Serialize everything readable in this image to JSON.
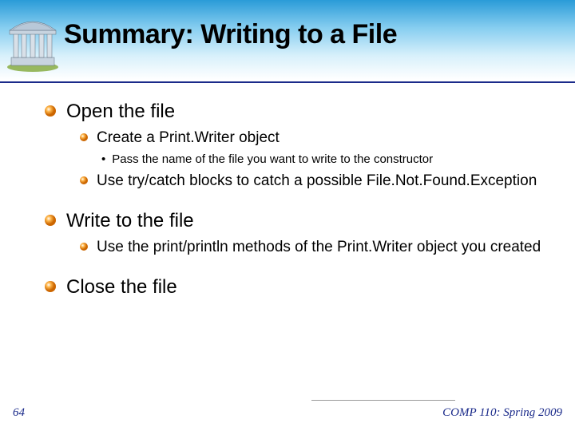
{
  "title": "Summary: Writing to a File",
  "bullets": [
    {
      "text": "Open the file",
      "children": [
        {
          "text": "Create a Print.Writer object",
          "children": [
            {
              "text": "Pass the name of the file you want to write to the constructor"
            }
          ]
        },
        {
          "text": "Use try/catch blocks to catch a possible File.Not.Found.Exception"
        }
      ]
    },
    {
      "text": "Write to the file",
      "children": [
        {
          "text": "Use the print/println methods of the Print.Writer object you created"
        }
      ]
    },
    {
      "text": "Close the file"
    }
  ],
  "pageNumber": "64",
  "courseInfo": "COMP 110: Spring 2009"
}
